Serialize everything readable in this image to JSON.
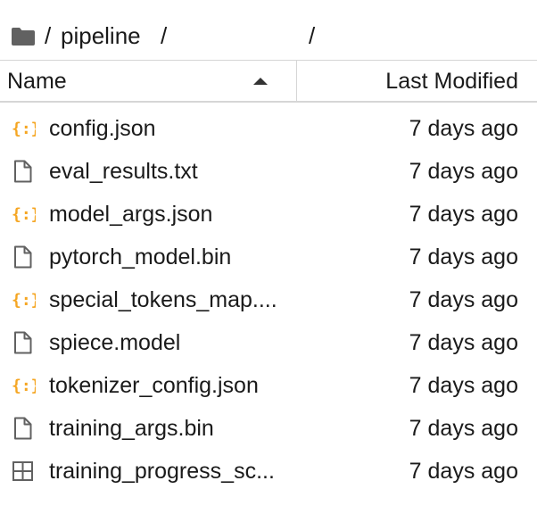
{
  "breadcrumb": {
    "folder_icon": "folder-icon",
    "sep_root": "/",
    "dir": "pipeline",
    "sep_after_dir": "/",
    "sep_trailing": "/"
  },
  "header": {
    "name_label": "Name",
    "modified_label": "Last Modified",
    "sort_indicator": "ascending"
  },
  "files": [
    {
      "name": "config.json",
      "modified": "7 days ago",
      "icon": "json-icon"
    },
    {
      "name": "eval_results.txt",
      "modified": "7 days ago",
      "icon": "file-icon"
    },
    {
      "name": "model_args.json",
      "modified": "7 days ago",
      "icon": "json-icon"
    },
    {
      "name": "pytorch_model.bin",
      "modified": "7 days ago",
      "icon": "file-icon"
    },
    {
      "name": "special_tokens_map....",
      "modified": "7 days ago",
      "icon": "json-icon"
    },
    {
      "name": "spiece.model",
      "modified": "7 days ago",
      "icon": "file-icon"
    },
    {
      "name": "tokenizer_config.json",
      "modified": "7 days ago",
      "icon": "json-icon"
    },
    {
      "name": "training_args.bin",
      "modified": "7 days ago",
      "icon": "file-icon"
    },
    {
      "name": "training_progress_sc...",
      "modified": "7 days ago",
      "icon": "spreadsheet-icon"
    }
  ],
  "colors": {
    "json_icon": "#f5a623",
    "file_icon": "#616161",
    "folder_icon": "#616161",
    "divider": "#d6d6d6"
  }
}
